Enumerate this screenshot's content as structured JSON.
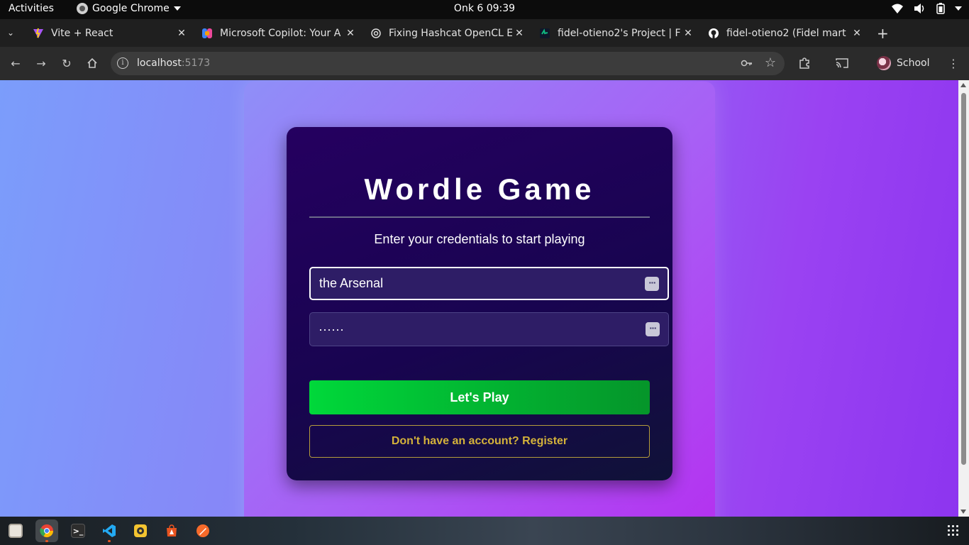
{
  "system_bar": {
    "activities": "Activities",
    "app_name": "Google Chrome",
    "clock": "Onk 6  09:39"
  },
  "browser": {
    "tabs": [
      {
        "title": "Vite + React",
        "favicon": "vite-icon",
        "color": "#a855f7"
      },
      {
        "title": "Microsoft Copilot: Your A",
        "favicon": "copilot-icon",
        "color": "#3b82f6"
      },
      {
        "title": "Fixing Hashcat OpenCL E",
        "favicon": "chatgpt-icon",
        "color": "#dddddd"
      },
      {
        "title": "fidel-otieno2's Project | F",
        "favicon": "project-icon",
        "color": "#10b981"
      },
      {
        "title": "fidel-otieno2 (Fidel mart",
        "favicon": "github-icon",
        "color": "#ffffff"
      }
    ],
    "new_tab": "+",
    "url_host": "localhost",
    "url_port": ":5173",
    "profile_name": "School"
  },
  "page": {
    "title": "Wordle Game",
    "subtitle": "Enter your credentials to start playing",
    "username_value": "the Arsenal",
    "password_value": "······",
    "play_button": "Let's Play",
    "register_link": "Don't have an account? Register"
  },
  "dock": {
    "apps": [
      "files-icon",
      "chrome-icon",
      "terminal-icon",
      "vscode-icon",
      "rhythmbox-icon",
      "app-center-icon",
      "drawing-icon"
    ]
  },
  "colors": {
    "play_button": "#00d83a",
    "register_text": "#d4b23a",
    "card_bg": "#1c0558"
  }
}
